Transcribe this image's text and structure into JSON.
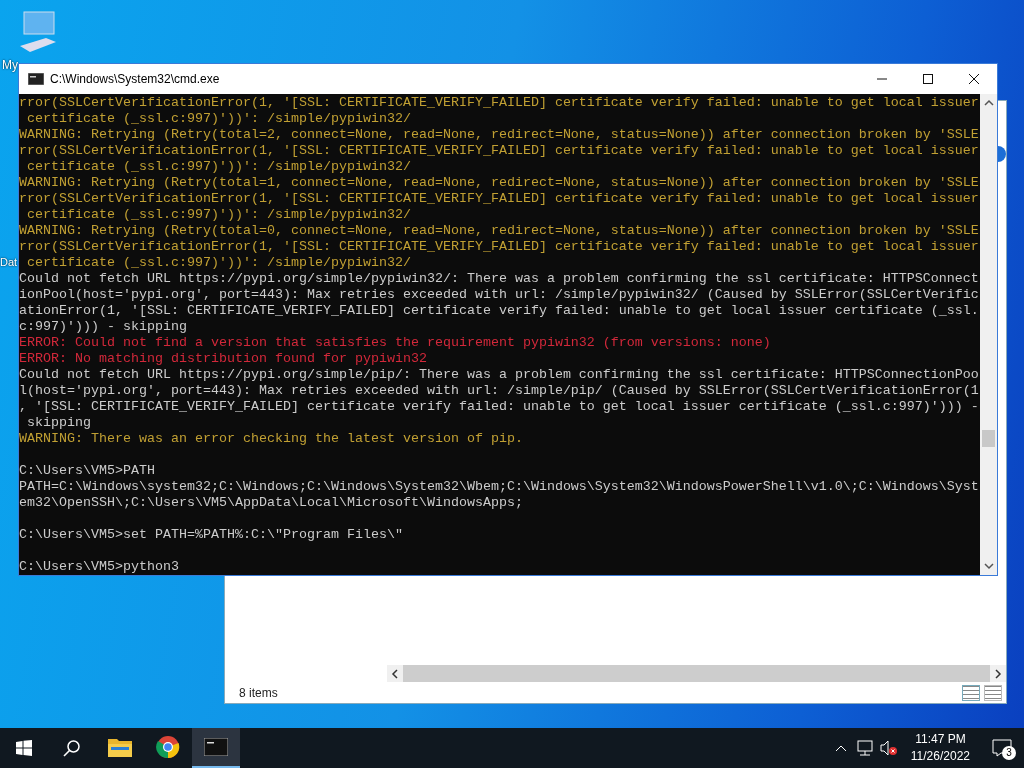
{
  "desktop": {
    "icons": [
      {
        "label": "My"
      },
      {
        "label": "Dat"
      }
    ]
  },
  "explorer": {
    "status": "8 items"
  },
  "console": {
    "title": "C:\\Windows\\System32\\cmd.exe",
    "lines": [
      {
        "kind": "warning",
        "text": "rror(SSLCertVerificationError(1, '[SSL: CERTIFICATE_VERIFY_FAILED] certificate verify failed: unable to get local issuer"
      },
      {
        "kind": "warning",
        "text": " certificate (_ssl.c:997)'))': /simple/pypiwin32/"
      },
      {
        "kind": "warning",
        "text": "WARNING: Retrying (Retry(total=2, connect=None, read=None, redirect=None, status=None)) after connection broken by 'SSLE"
      },
      {
        "kind": "warning",
        "text": "rror(SSLCertVerificationError(1, '[SSL: CERTIFICATE_VERIFY_FAILED] certificate verify failed: unable to get local issuer"
      },
      {
        "kind": "warning",
        "text": " certificate (_ssl.c:997)'))': /simple/pypiwin32/"
      },
      {
        "kind": "warning",
        "text": "WARNING: Retrying (Retry(total=1, connect=None, read=None, redirect=None, status=None)) after connection broken by 'SSLE"
      },
      {
        "kind": "warning",
        "text": "rror(SSLCertVerificationError(1, '[SSL: CERTIFICATE_VERIFY_FAILED] certificate verify failed: unable to get local issuer"
      },
      {
        "kind": "warning",
        "text": " certificate (_ssl.c:997)'))': /simple/pypiwin32/"
      },
      {
        "kind": "warning",
        "text": "WARNING: Retrying (Retry(total=0, connect=None, read=None, redirect=None, status=None)) after connection broken by 'SSLE"
      },
      {
        "kind": "warning",
        "text": "rror(SSLCertVerificationError(1, '[SSL: CERTIFICATE_VERIFY_FAILED] certificate verify failed: unable to get local issuer"
      },
      {
        "kind": "warning",
        "text": " certificate (_ssl.c:997)'))': /simple/pypiwin32/"
      },
      {
        "kind": "normal",
        "text": "Could not fetch URL https://pypi.org/simple/pypiwin32/: There was a problem confirming the ssl certificate: HTTPSConnect"
      },
      {
        "kind": "normal",
        "text": "ionPool(host='pypi.org', port=443): Max retries exceeded with url: /simple/pypiwin32/ (Caused by SSLError(SSLCertVerific"
      },
      {
        "kind": "normal",
        "text": "ationError(1, '[SSL: CERTIFICATE_VERIFY_FAILED] certificate verify failed: unable to get local issuer certificate (_ssl."
      },
      {
        "kind": "normal",
        "text": "c:997)'))) - skipping"
      },
      {
        "kind": "error",
        "text": "ERROR: Could not find a version that satisfies the requirement pypiwin32 (from versions: none)"
      },
      {
        "kind": "error",
        "text": "ERROR: No matching distribution found for pypiwin32"
      },
      {
        "kind": "normal",
        "text": "Could not fetch URL https://pypi.org/simple/pip/: There was a problem confirming the ssl certificate: HTTPSConnectionPoo"
      },
      {
        "kind": "normal",
        "text": "l(host='pypi.org', port=443): Max retries exceeded with url: /simple/pip/ (Caused by SSLError(SSLCertVerificationError(1"
      },
      {
        "kind": "normal",
        "text": ", '[SSL: CERTIFICATE_VERIFY_FAILED] certificate verify failed: unable to get local issuer certificate (_ssl.c:997)'))) -"
      },
      {
        "kind": "normal",
        "text": " skipping"
      },
      {
        "kind": "warning",
        "text": "WARNING: There was an error checking the latest version of pip."
      },
      {
        "kind": "blank"
      },
      {
        "kind": "normal",
        "text": "C:\\Users\\VM5>PATH"
      },
      {
        "kind": "normal",
        "text": "PATH=C:\\Windows\\system32;C:\\Windows;C:\\Windows\\System32\\Wbem;C:\\Windows\\System32\\WindowsPowerShell\\v1.0\\;C:\\Windows\\Syst"
      },
      {
        "kind": "normal",
        "text": "em32\\OpenSSH\\;C:\\Users\\VM5\\AppData\\Local\\Microsoft\\WindowsApps;"
      },
      {
        "kind": "blank"
      },
      {
        "kind": "normal",
        "text": "C:\\Users\\VM5>set PATH=%PATH%:C:\\\"Program Files\\\""
      },
      {
        "kind": "blank"
      },
      {
        "kind": "normal",
        "text": "C:\\Users\\VM5>python3"
      }
    ]
  },
  "taskbar": {
    "apps": [
      {
        "kind": "folder",
        "selected": false
      },
      {
        "kind": "browser",
        "selected": false
      },
      {
        "kind": "terminal",
        "selected": true
      }
    ],
    "time": "11:47 PM",
    "date": "11/26/2022",
    "notifications": "3"
  }
}
